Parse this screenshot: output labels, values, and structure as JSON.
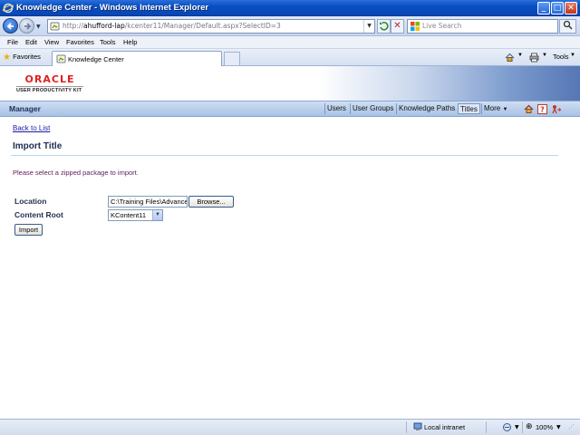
{
  "window": {
    "title": "Knowledge Center - Windows Internet Explorer"
  },
  "addressbar": {
    "url_prefix": "http://",
    "url_host": "ahufford-lap",
    "url_path": "/kcenter11/Manager/Default.aspx?SelectID=3",
    "search_placeholder": "Live Search"
  },
  "menu": [
    "File",
    "Edit",
    "View",
    "Favorites",
    "Tools",
    "Help"
  ],
  "favorites": {
    "label": "Favorites",
    "tab_label": "Knowledge Center",
    "tools_label": "Tools"
  },
  "header": {
    "brand": "ORACLE",
    "product": "USER PRODUCTIVITY KIT"
  },
  "nav": {
    "section": "Manager",
    "links": [
      "Users",
      "User Groups",
      "Knowledge Paths",
      "Titles",
      "More"
    ],
    "active": "Titles"
  },
  "page": {
    "back_link": "Back to List",
    "title": "Import Title",
    "instruction": "Please select a zipped package to import.",
    "location_label": "Location",
    "location_value": "C:\\Training Files\\Advanced",
    "browse_label": "Browse...",
    "content_root_label": "Content Root",
    "content_root_value": "KContent11",
    "import_label": "Import"
  },
  "status": {
    "zone": "Local intranet",
    "zoom": "100%"
  },
  "colors": {
    "title_bar": "#0a4fc4",
    "oracle_red": "#e02020",
    "link": "#1a1aa8",
    "instruction": "#5b1b56"
  }
}
